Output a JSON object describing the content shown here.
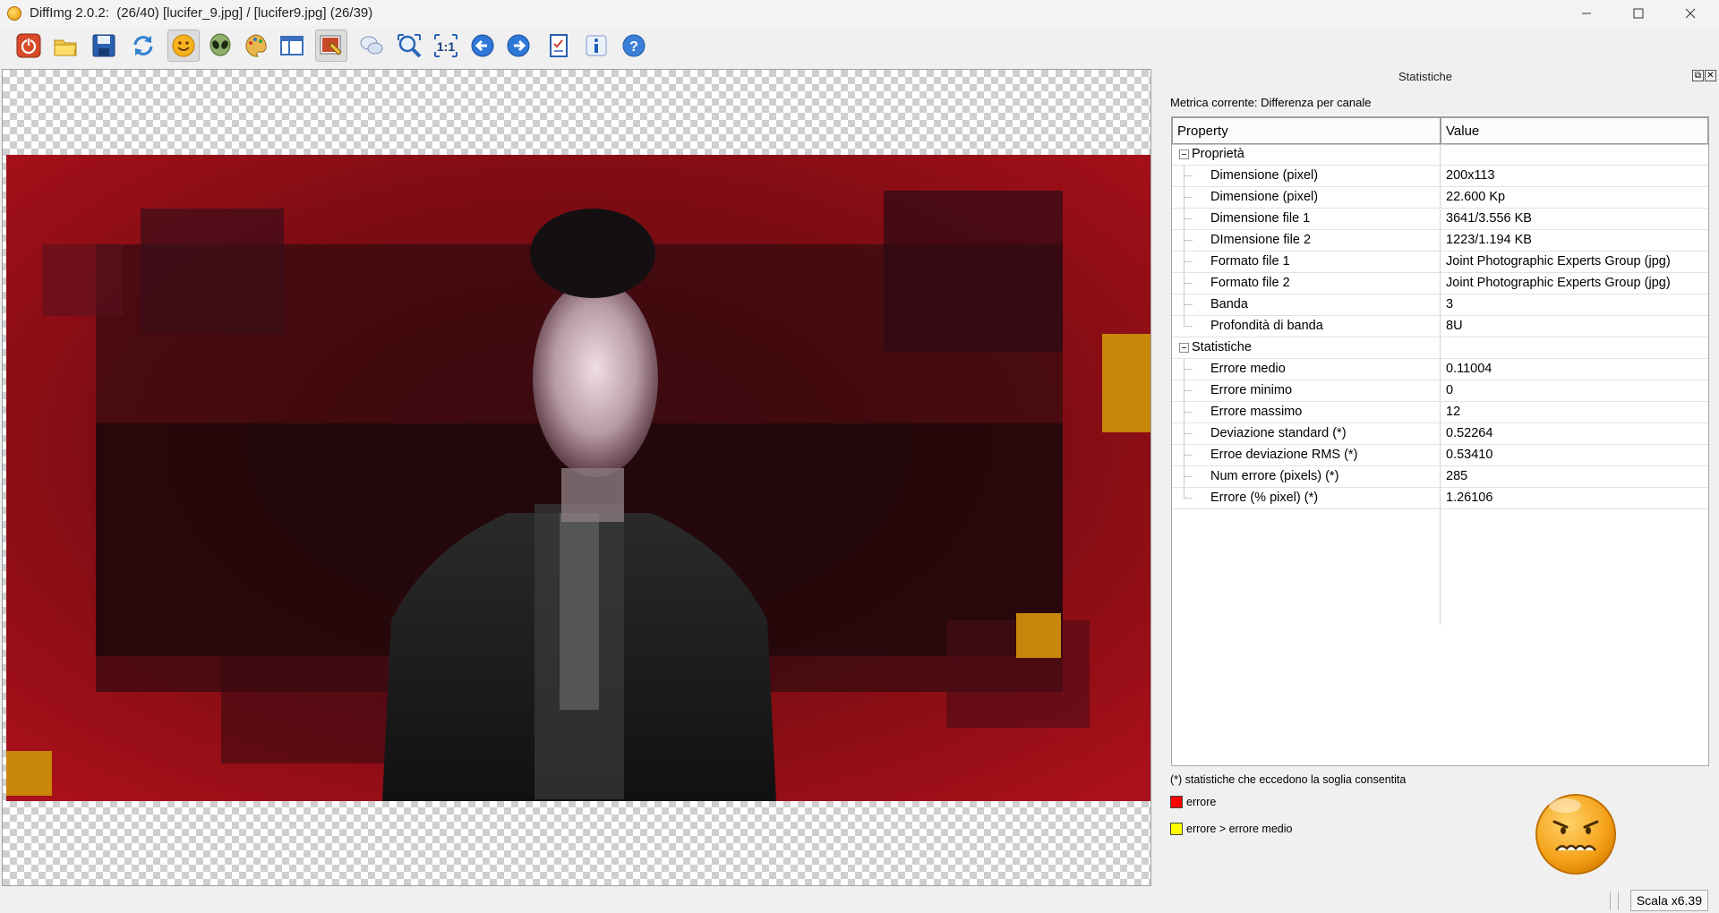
{
  "window": {
    "title": "DiffImg 2.0.2:  (26/40) [lucifer_9.jpg] / [lucifer9.jpg] (26/39)"
  },
  "toolbar": {
    "buttons": [
      {
        "icon": "power-icon"
      },
      {
        "icon": "folder-open-icon"
      },
      {
        "icon": "save-icon"
      },
      {
        "icon": "refresh-icon"
      },
      {
        "icon": "smiley-icon",
        "active": true
      },
      {
        "icon": "alien-icon"
      },
      {
        "icon": "palette-icon"
      },
      {
        "icon": "layout-icon"
      },
      {
        "icon": "highlight-diff-icon",
        "active": true
      },
      {
        "icon": "chat-bubbles-icon"
      },
      {
        "icon": "zoom-fit-icon"
      },
      {
        "icon": "zoom-1to1-icon",
        "label": "1:1"
      },
      {
        "icon": "arrow-left-icon"
      },
      {
        "icon": "arrow-right-icon"
      },
      {
        "icon": "checklist-icon"
      },
      {
        "icon": "info-icon"
      },
      {
        "icon": "help-icon"
      }
    ]
  },
  "stats_panel": {
    "title": "Statistiche",
    "metric_label": "Metrica corrente: Differenza per canale",
    "columns": {
      "property": "Property",
      "value": "Value"
    },
    "groups": [
      {
        "name": "Proprietà",
        "rows": [
          {
            "label": "Dimensione (pixel)",
            "value": "200x113"
          },
          {
            "label": "Dimensione (pixel)",
            "value": "22.600 Kp"
          },
          {
            "label": "Dimensione file 1",
            "value": "3641/3.556 KB"
          },
          {
            "label": "DImensione file 2",
            "value": "1223/1.194 KB"
          },
          {
            "label": "Formato file 1",
            "value": "Joint Photographic Experts Group (jpg)"
          },
          {
            "label": "Formato file 2",
            "value": "Joint Photographic Experts Group (jpg)"
          },
          {
            "label": "Banda",
            "value": "3"
          },
          {
            "label": "Profondità di banda",
            "value": "8U"
          }
        ]
      },
      {
        "name": "Statistiche",
        "rows": [
          {
            "label": "Errore medio",
            "value": "0.11004"
          },
          {
            "label": "Errore minimo",
            "value": "0"
          },
          {
            "label": "Errore massimo",
            "value": "12"
          },
          {
            "label": "Deviazione standard (*)",
            "value": "0.52264"
          },
          {
            "label": "Erroe deviazione RMS (*)",
            "value": "0.53410"
          },
          {
            "label": "Num errore (pixels) (*)",
            "value": "285"
          },
          {
            "label": "Errore (% pixel) (*)",
            "value": "1.26106"
          }
        ]
      }
    ],
    "footnote": "(*) statistiche che eccedono la soglia consentita",
    "legend": [
      {
        "label": "errore",
        "color": "#ff0000"
      },
      {
        "label": "errore > errore medio",
        "color": "#ffff00"
      }
    ],
    "status_face_icon": "angry-face-icon"
  },
  "statusbar": {
    "scale": "Scala x6.39"
  },
  "colors": {
    "error_highlight": "#c8860a",
    "image_dominant_red": "#8a0c14"
  }
}
